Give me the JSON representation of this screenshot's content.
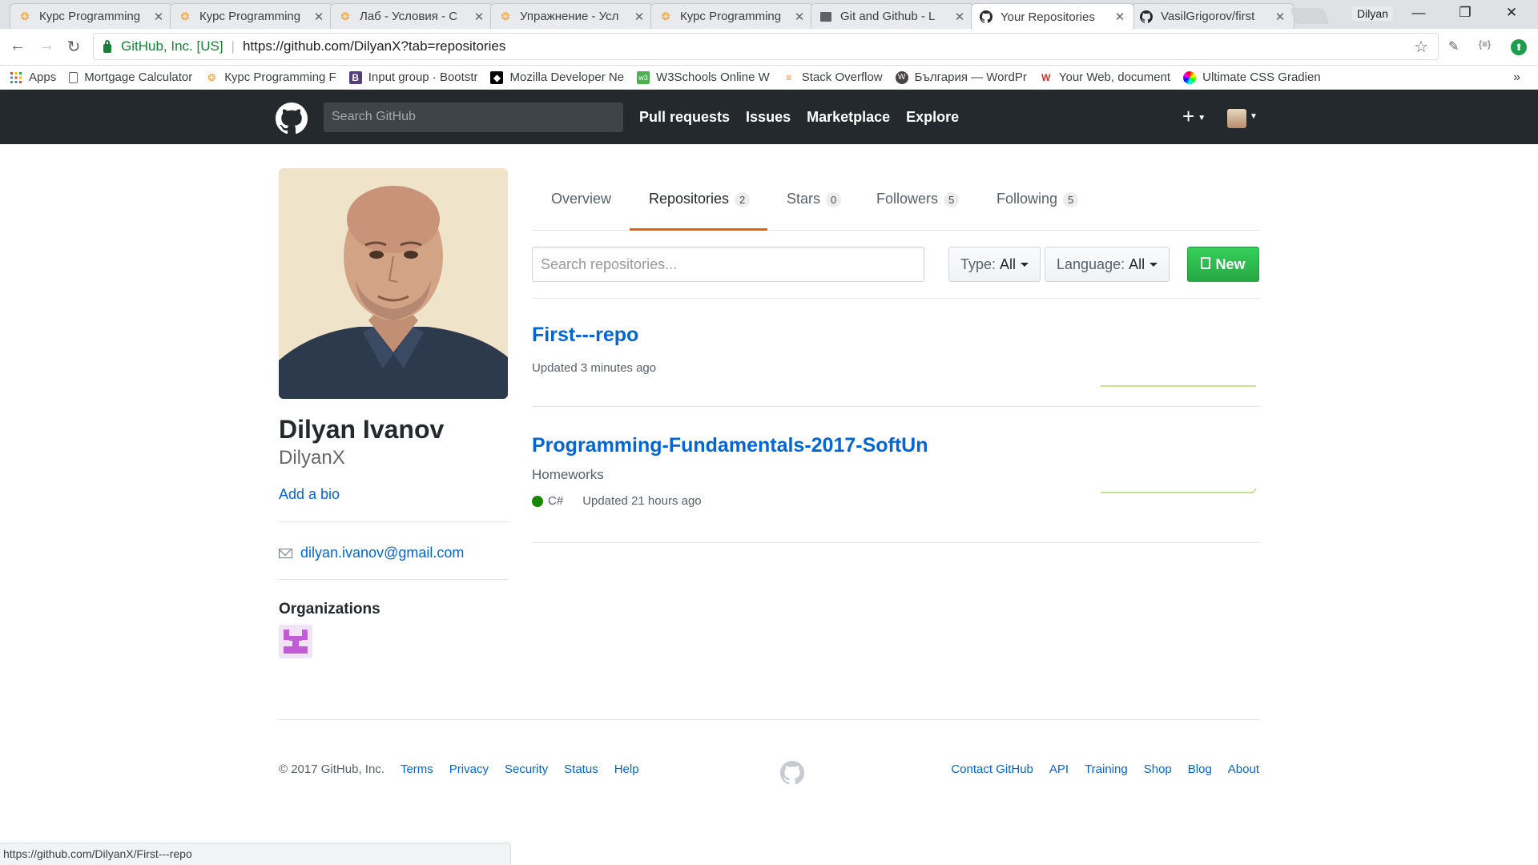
{
  "browser": {
    "tabs": [
      {
        "title": "Курс Programming",
        "icon": "softuni-icon",
        "active": false
      },
      {
        "title": "Курс Programming",
        "icon": "softuni-icon",
        "active": false
      },
      {
        "title": "Лаб - Условия - С",
        "icon": "softuni-icon",
        "active": false
      },
      {
        "title": "Упражнение - Усл",
        "icon": "softuni-icon",
        "active": false
      },
      {
        "title": "Курс Programming",
        "icon": "softuni-icon",
        "active": false
      },
      {
        "title": "Git and Github - L",
        "icon": "document-icon",
        "active": false
      },
      {
        "title": "Your Repositories",
        "icon": "github-icon",
        "active": true
      },
      {
        "title": "VasilGrigorov/first",
        "icon": "github-icon",
        "active": false
      }
    ],
    "profile_name": "Dilyan",
    "secure_label": "GitHub, Inc. [US]",
    "url": "https://github.com/DilyanX?tab=repositories",
    "bookmarks": [
      {
        "label": "Apps",
        "icon": "apps-grid-icon"
      },
      {
        "label": "Mortgage Calculator",
        "icon": "page-icon"
      },
      {
        "label": "Курс Programming F",
        "icon": "softuni-icon"
      },
      {
        "label": "Input group · Bootstr",
        "icon": "bootstrap-icon"
      },
      {
        "label": "Mozilla Developer Ne",
        "icon": "mdn-icon"
      },
      {
        "label": "W3Schools Online W",
        "icon": "w3schools-icon"
      },
      {
        "label": "Stack Overflow",
        "icon": "stackoverflow-icon"
      },
      {
        "label": "България — WordPr",
        "icon": "wordpress-icon"
      },
      {
        "label": "Your Web, document",
        "icon": "webflow-icon"
      },
      {
        "label": "Ultimate CSS Gradien",
        "icon": "gradient-icon"
      }
    ],
    "status_url": "https://github.com/DilyanX/First---repo"
  },
  "github_header": {
    "search_placeholder": "Search GitHub",
    "nav": [
      "Pull requests",
      "Issues",
      "Marketplace",
      "Explore"
    ]
  },
  "profile": {
    "full_name": "Dilyan Ivanov",
    "username": "DilyanX",
    "add_bio": "Add a bio",
    "email": "dilyan.ivanov@gmail.com",
    "organizations_title": "Organizations"
  },
  "profile_tabs": [
    {
      "label": "Overview",
      "count": null
    },
    {
      "label": "Repositories",
      "count": "2",
      "selected": true
    },
    {
      "label": "Stars",
      "count": "0"
    },
    {
      "label": "Followers",
      "count": "5"
    },
    {
      "label": "Following",
      "count": "5"
    }
  ],
  "filters": {
    "search_placeholder": "Search repositories...",
    "type_label": "Type:",
    "type_value": "All",
    "language_label": "Language:",
    "language_value": "All",
    "new_button": "New"
  },
  "repos": [
    {
      "name": "First---repo",
      "description": "",
      "language": "",
      "updated": "Updated 3 minutes ago"
    },
    {
      "name": "Programming-Fundamentals-2017-SoftUn",
      "description": "Homeworks",
      "language": "C#",
      "updated": "Updated 21 hours ago"
    }
  ],
  "footer": {
    "copyright": "© 2017 GitHub, Inc.",
    "left_links": [
      "Terms",
      "Privacy",
      "Security",
      "Status",
      "Help"
    ],
    "right_links": [
      "Contact GitHub",
      "API",
      "Training",
      "Shop",
      "Blog",
      "About"
    ]
  },
  "colors": {
    "header_bg": "#24292e",
    "link": "#0366d6",
    "selected_tab_accent": "#e36209",
    "new_button": "#28a745",
    "csharp_language": "#178600"
  }
}
